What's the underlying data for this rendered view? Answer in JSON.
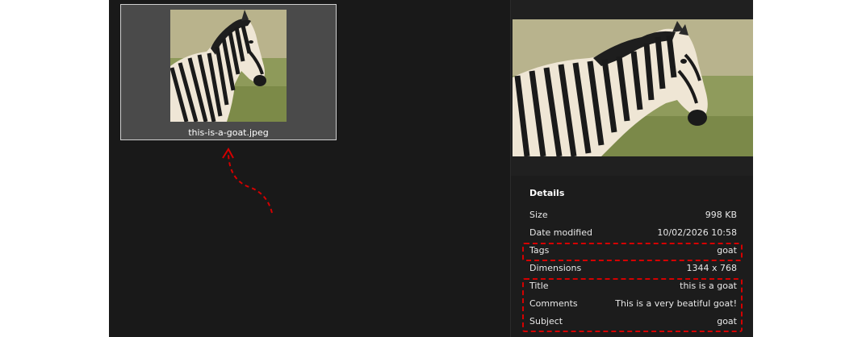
{
  "file": {
    "name": "this-is-a-goat.jpeg"
  },
  "details": {
    "heading": "Details",
    "properties": [
      {
        "label": "Size",
        "value": "998 KB"
      },
      {
        "label": "Date modified",
        "value": "10/02/2026 10:58"
      },
      {
        "label": "Tags",
        "value": "goat"
      },
      {
        "label": "Dimensions",
        "value": "1344 x 768"
      },
      {
        "label": "Title",
        "value": "this is a goat"
      },
      {
        "label": "Comments",
        "value": "This is a very beatiful goat!"
      },
      {
        "label": "Subject",
        "value": "goat"
      }
    ]
  },
  "annotations": {
    "color": "#d40000",
    "highlighted_properties": [
      "Tags",
      "Title",
      "Comments",
      "Subject"
    ],
    "arrow_target": "file-tile"
  },
  "theme": {
    "background": "#191919",
    "tile_selected": "#4a4a4a",
    "tile_border": "#cfcfcf",
    "text": "#ffffff"
  },
  "icons": {
    "thumbnail": "zebra-photo",
    "preview": "zebra-photo"
  }
}
